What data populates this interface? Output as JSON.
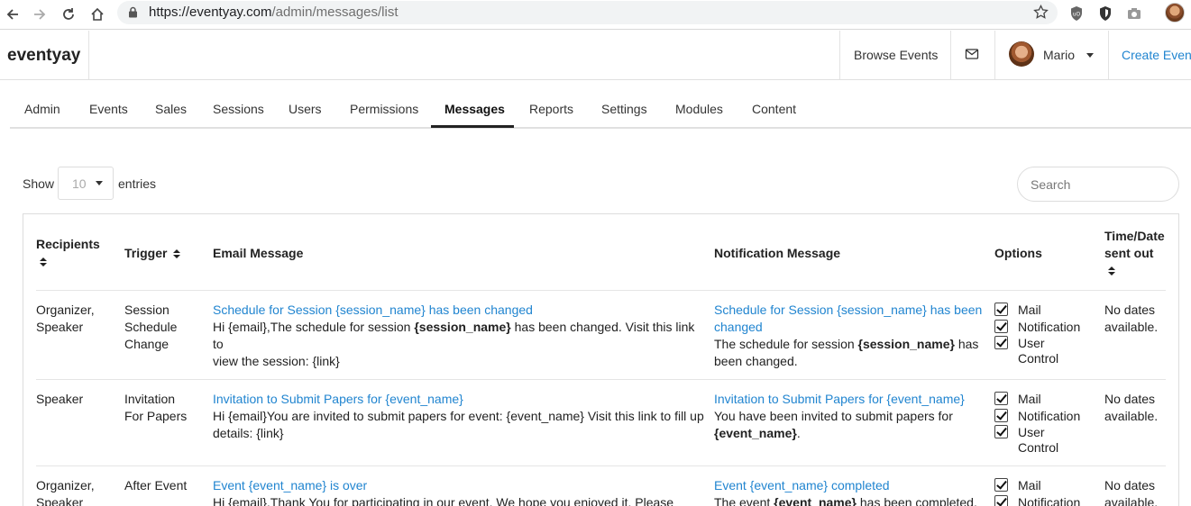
{
  "browser": {
    "url_host": "https://eventyay.com",
    "url_path": "/admin/messages/list"
  },
  "header": {
    "brand": "eventyay",
    "browse_events": "Browse Events",
    "user_name": "Mario",
    "create_event": "Create Event"
  },
  "tabs": [
    "Admin",
    "Events",
    "Sales",
    "Sessions",
    "Users",
    "Permissions",
    "Messages",
    "Reports",
    "Settings",
    "Modules",
    "Content"
  ],
  "active_tab": "Messages",
  "controls": {
    "show_label": "Show",
    "page_size": "10",
    "entries_label": "entries",
    "search_placeholder": "Search"
  },
  "table": {
    "columns": {
      "recipients": "Recipients",
      "trigger": "Trigger",
      "email": "Email Message",
      "notification": "Notification Message",
      "options": "Options",
      "time_l1": "Time/Date",
      "time_l2": "sent out"
    },
    "options_labels": {
      "mail": "Mail",
      "notification": "Notification",
      "user": "User",
      "control": "Control"
    },
    "rows": [
      {
        "recipients_l1": "Organizer,",
        "recipients_l2": "Speaker",
        "trigger_l1": "Session",
        "trigger_l2": "Schedule",
        "trigger_l3": "Change",
        "email_subject": "Schedule for Session {session_name} has been changed",
        "email_body_a": "Hi {email},The schedule for session ",
        "email_body_bold": "{session_name}",
        "email_body_b": " has been changed. Visit this link to",
        "email_body_l2": "view the session: {link}",
        "notif_subject_l1": "Schedule for Session {session_name} has been",
        "notif_subject_l2": "changed",
        "notif_body_a": "The schedule for session ",
        "notif_body_bold": "{session_name}",
        "notif_body_b": " has",
        "notif_body_l2": "been changed.",
        "time_l1": "No dates",
        "time_l2": "available."
      },
      {
        "recipients_l1": "Speaker",
        "trigger_l1": "Invitation",
        "trigger_l2": "For Papers",
        "email_subject": "Invitation to Submit Papers for {event_name}",
        "email_body_l1": "Hi {email}You are invited to submit papers for event: {event_name} Visit this link to fill up",
        "email_body_l2": "details: {link}",
        "notif_subject_l1": "Invitation to Submit Papers for {event_name}",
        "notif_body_l1": "You have been invited to submit papers for",
        "notif_body_bold": "{event_name}",
        "notif_body_end": ".",
        "time_l1": "No dates",
        "time_l2": "available."
      },
      {
        "recipients_l1": "Organizer,",
        "recipients_l2": "Speaker",
        "trigger_l1": "After Event",
        "email_subject": "Event {event_name} is over",
        "email_body_l1": "Hi {email},Thank You for participating in our event. We hope you enjoyed it. Please check",
        "notif_subject_l1": "Event {event_name} completed",
        "notif_body_a": "The event ",
        "notif_body_bold": "{event_name}",
        "notif_body_b": " has been completed.",
        "time_l1": "No dates",
        "time_l2": "available."
      }
    ]
  }
}
